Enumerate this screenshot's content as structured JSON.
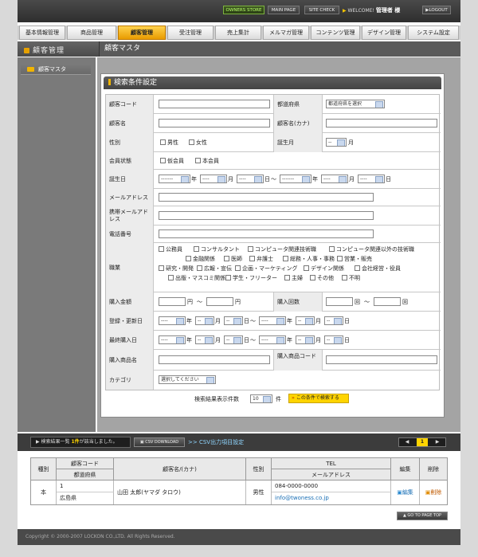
{
  "header": {
    "owners_store": "OWNERS STORE",
    "main_page": "MAIN PAGE",
    "site_check": "SITE CHECK",
    "welcome_label": "WELCOME!",
    "user_name": "管理者 様",
    "logout": "LOGOUT"
  },
  "tabs": [
    {
      "label": "基本情報管理"
    },
    {
      "label": "商品管理"
    },
    {
      "label": "顧客管理"
    },
    {
      "label": "受注管理"
    },
    {
      "label": "売上集計"
    },
    {
      "label": "メルマガ管理"
    },
    {
      "label": "コンテンツ管理"
    },
    {
      "label": "デザイン管理"
    },
    {
      "label": "システム設定"
    }
  ],
  "section": {
    "title": "顧客管理",
    "subtitle": "顧客マスタ"
  },
  "sidebar": {
    "items": [
      {
        "label": "顧客マスタ"
      }
    ]
  },
  "search": {
    "heading": "検索条件設定",
    "labels": {
      "customer_code": "顧客コード",
      "prefecture": "都道府県",
      "customer_name": "顧客名",
      "customer_kana": "顧客名(カナ)",
      "gender": "性別",
      "birth_month": "誕生月",
      "member_status": "会員状態",
      "birthday": "誕生日",
      "email": "メールアドレス",
      "mobile_email": "携帯メールアドレス",
      "phone": "電話番号",
      "occupation": "職業",
      "purchase_amount": "購入金額",
      "purchase_count": "購入回数",
      "registered_updated": "登録・更新日",
      "last_purchase": "最終購入日",
      "product_name": "購入商品名",
      "product_code": "購入商品コード",
      "category": "カテゴリ"
    },
    "prefecture_select": "都道府県を選択",
    "gender_options": [
      "男性",
      "女性"
    ],
    "member_options": [
      "仮会員",
      "本会員"
    ],
    "month_select": "--",
    "month_unit": "月",
    "year_select": "-------",
    "day_select": "----",
    "small_select": "--",
    "year_unit": "年",
    "day_unit": "日",
    "range_sep": "〜",
    "yen": "円",
    "times": "回",
    "occupations": [
      "公務員",
      "コンサルタント",
      "コンピュータ関連技術職",
      "コンピュータ関連以外の技術職",
      "金融関係",
      "医師",
      "弁護士",
      "総務・人事・事務",
      "営業・販売",
      "研究・開発",
      "広報・宣伝",
      "企画・マーケティング",
      "デザイン関係",
      "会社経営・役員",
      "出版・マスコミ関係",
      "学生・フリーター",
      "主婦",
      "その他",
      "不明"
    ],
    "category_select": "選択してください",
    "result_count_label": "検索結果表示件数",
    "result_count": "10",
    "result_count_unit": "件",
    "search_button": "この条件で検索する"
  },
  "results": {
    "summary_prefix": "検索結果一覧",
    "hit_count": "1件",
    "summary_suffix": "が該当しました。",
    "csv_download": "CSV DOWNLOAD",
    "csv_settings": "CSV出力項目設定",
    "page": "1",
    "prev": "◀",
    "next": "▶",
    "headers": {
      "type": "種別",
      "customer_code": "顧客コード",
      "prefecture": "都道府県",
      "name_kana": "顧客名/(カナ)",
      "gender": "性別",
      "tel": "TEL",
      "email": "メールアドレス",
      "edit": "編集",
      "delete": "削除"
    },
    "rows": [
      {
        "type": "本",
        "customer_code": "1",
        "prefecture": "広島県",
        "name": "山田 太郎(ヤマダ タロウ)",
        "gender": "男性",
        "tel": "084-0000-0000",
        "email": "info@twoness.co.jp",
        "edit": "編集",
        "delete": "削除"
      }
    ]
  },
  "go_to_top": "GO TO PAGE TOP",
  "footer": "Copyright © 2000-2007 LOCKON CO.,LTD. All Rights Reserved."
}
